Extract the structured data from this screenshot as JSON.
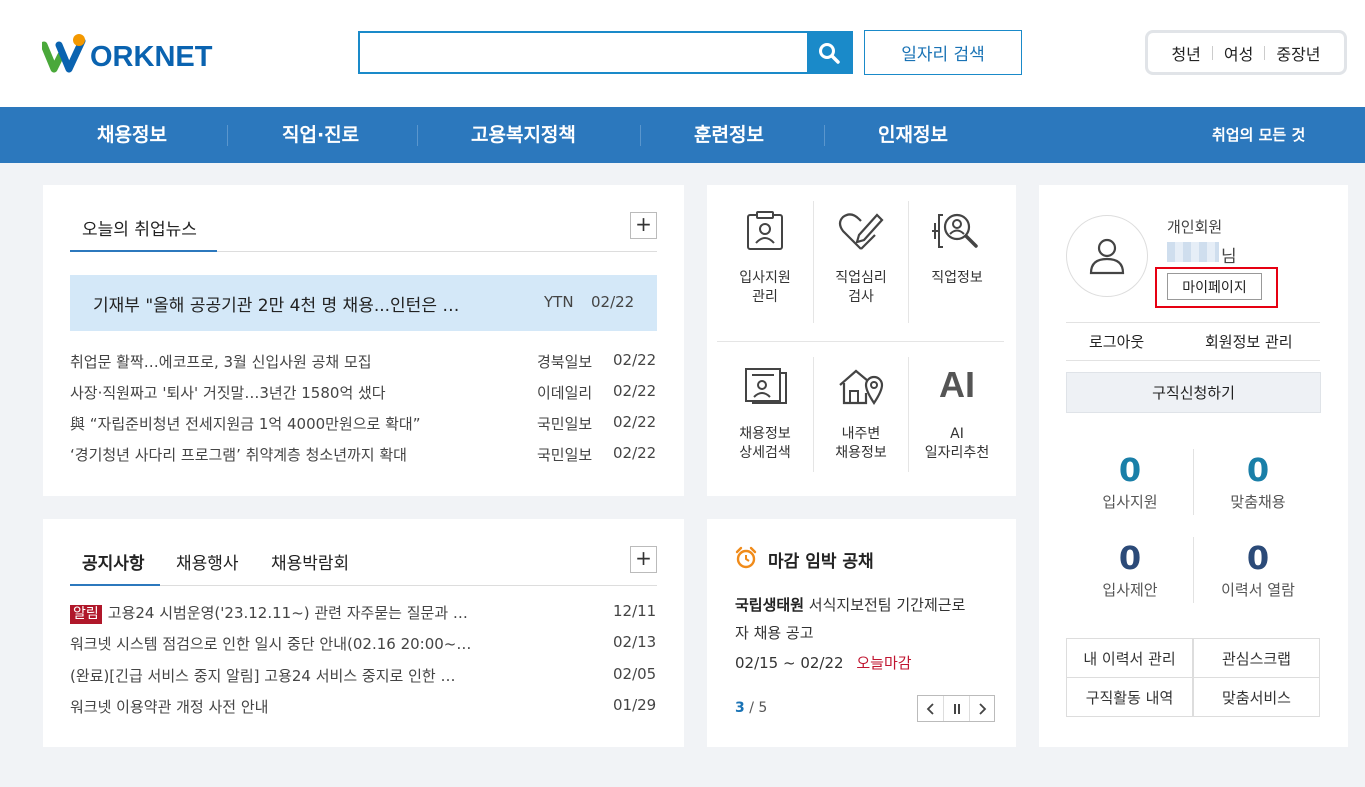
{
  "header": {
    "logo_text": "ORKNET",
    "search_placeholder": "",
    "job_search_label": "일자리 검색",
    "quick_links": [
      "청년",
      "여성",
      "중장년"
    ]
  },
  "gnb": {
    "items": [
      "채용정보",
      "직업·진로",
      "고용복지정책",
      "훈련정보",
      "인재정보"
    ],
    "all_label": "취업의 모든 것"
  },
  "news": {
    "title": "오늘의 취업뉴스",
    "plus": "+",
    "headline": {
      "title": "기재부 \"올해 공공기관 2만 4천 명 채용...인턴은 …",
      "source": "YTN",
      "date": "02/22"
    },
    "items": [
      {
        "title": "취업문 활짝…에코프로, 3월 신입사원 공채 모집",
        "source": "경북일보",
        "date": "02/22"
      },
      {
        "title": "사장·직원짜고 '퇴사' 거짓말…3년간 1580억 샜다",
        "source": "이데일리",
        "date": "02/22"
      },
      {
        "title": "與 “자립준비청년 전세지원금 1억 4000만원으로 확대”",
        "source": "국민일보",
        "date": "02/22"
      },
      {
        "title": "‘경기청년 사다리 프로그램’ 취약계층 청소년까지 확대",
        "source": "국민일보",
        "date": "02/22"
      }
    ]
  },
  "notice": {
    "tabs": [
      "공지사항",
      "채용행사",
      "채용박람회"
    ],
    "plus": "+",
    "badge": "알림",
    "items": [
      {
        "title": "고용24 시범운영('23.12.11~) 관련 자주묻는 질문과 …",
        "date": "12/11"
      },
      {
        "title": "워크넷 시스템 점검으로 인한 일시 중단 안내(02.16 20:00~…",
        "date": "02/13"
      },
      {
        "title": "(완료)[긴급 서비스 중지 알림] 고용24 서비스 중지로 인한 …",
        "date": "02/05"
      },
      {
        "title": "워크넷 이용약관 개정 사전 안내",
        "date": "01/29"
      }
    ]
  },
  "menu": {
    "items": [
      {
        "line1": "입사지원",
        "line2": "관리",
        "icon": "applicant-card-icon"
      },
      {
        "line1": "직업심리",
        "line2": "검사",
        "icon": "heart-pencil-icon"
      },
      {
        "line1": "직업정보",
        "line2": "",
        "icon": "magnifier-person-icon"
      },
      {
        "line1": "채용정보",
        "line2": "상세검색",
        "icon": "document-scroll-icon"
      },
      {
        "line1": "내주변",
        "line2": "채용정보",
        "icon": "house-pin-icon"
      },
      {
        "line1": "AI",
        "line2": "일자리추천",
        "icon": "ai-icon"
      }
    ],
    "ai_glyph": "AI"
  },
  "deadline": {
    "title": "마감 임박 공채",
    "company": "국립생태원",
    "desc_line1": "서식지보전팀 기간제근로",
    "desc_line2": "자 채용 공고",
    "period": "02/15 ~ 02/22",
    "status": "오늘마감",
    "page_current": "3",
    "page_total": "/ 5"
  },
  "profile": {
    "member_type": "개인회원",
    "name_suffix": "님",
    "mypage_label": "마이페이지",
    "logout_label": "로그아웃",
    "member_info_label": "회원정보 관리",
    "apply_label": "구직신청하기",
    "stats": [
      {
        "value": "0",
        "label": "입사지원"
      },
      {
        "value": "0",
        "label": "맞춤채용"
      },
      {
        "value": "0",
        "label": "입사제안"
      },
      {
        "value": "0",
        "label": "이력서 열람"
      }
    ],
    "links": [
      "내 이력서 관리",
      "관심스크랩",
      "구직활동 내역",
      "맞춤서비스"
    ]
  },
  "colors": {
    "brand_blue": "#2c78bd",
    "accent_teal": "#1a8ac9",
    "stat_teal": "#1a7fa8",
    "stat_navy": "#2b4a78",
    "alert_red": "#b0172a",
    "highlight_red": "#e60012"
  }
}
